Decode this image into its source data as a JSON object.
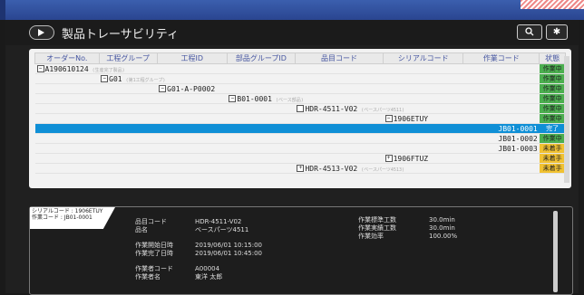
{
  "app": {
    "title": "製品トレーサビリティ"
  },
  "colors": {
    "status_working": "#4caf50",
    "status_done": "#f1c232",
    "status_not_started": "#f1c232",
    "selected_row": "#0f8fd6"
  },
  "header": {
    "search_icon": "search-icon",
    "settings_icon": "gear-icon"
  },
  "table": {
    "columns": [
      "オーダーNo.",
      "工程グループ",
      "工程ID",
      "部品グループID",
      "品目コード",
      "シリアルコード",
      "作業コード",
      "状態"
    ],
    "rows": [
      {
        "level": 0,
        "box": "−",
        "text": "A190610124",
        "sub": "(生産完了製品)",
        "status": "作業中",
        "st": "g"
      },
      {
        "level": 1,
        "box": "−",
        "text": "G01",
        "sub": "(第1工程グループ)",
        "status": "作業中",
        "st": "g"
      },
      {
        "level": 2,
        "box": "−",
        "text": "G01-A-P0002",
        "sub": "",
        "status": "作業中",
        "st": "g"
      },
      {
        "level": 3,
        "box": "−",
        "text": "B01-0001",
        "sub": "(ベース部品)",
        "status": "作業中",
        "st": "g"
      },
      {
        "level": 4,
        "box": " ",
        "text": "HDR-4511-V02",
        "sub": "(ベースパーツ4511)",
        "status": "作業中",
        "st": "g"
      },
      {
        "level": 5,
        "box": "−",
        "text": "1906ETUY",
        "sub": "",
        "status": "作業中",
        "st": "g"
      },
      {
        "level": 6,
        "box": "",
        "text": "JB01-0001",
        "sub": "",
        "status": "完了",
        "st": "y",
        "selected": true
      },
      {
        "level": 6,
        "box": "",
        "text": "JB01-0002",
        "sub": "",
        "status": "作業中",
        "st": "g"
      },
      {
        "level": 6,
        "box": "",
        "text": "JB01-0003",
        "sub": "",
        "status": "未着手",
        "st": "y"
      },
      {
        "level": 5,
        "box": "+",
        "text": "1906FTUZ",
        "sub": "",
        "status": "未着手",
        "st": "y"
      },
      {
        "level": 4,
        "box": "+",
        "text": "HDR-4513-V02",
        "sub": "(ベースパーツ4513)",
        "status": "未着手",
        "st": "y"
      }
    ]
  },
  "detail": {
    "tag_line1": "シリアルコード : 1906ETUY",
    "tag_line2": "作業コード : JB01-0001",
    "item_code_label": "品目コード",
    "item_name_label": "品名",
    "item_code": "HDR-4511-V02",
    "item_name": "ベースパーツ4511",
    "start_label": "作業開始日時",
    "end_label": "作業完了日時",
    "start_time": "2019/06/01 10:15:00",
    "end_time": "2019/06/01 10:45:00",
    "worker_code_label": "作業者コード",
    "worker_name_label": "作業者名",
    "worker_code": "A00004",
    "worker_name": "東洋 太郎",
    "std_time_label": "作業標準工数",
    "actual_time_label": "作業実績工数",
    "efficiency_label": "作業効率",
    "std_time": "30.0min",
    "actual_time": "30.0min",
    "efficiency": "100.00%"
  }
}
